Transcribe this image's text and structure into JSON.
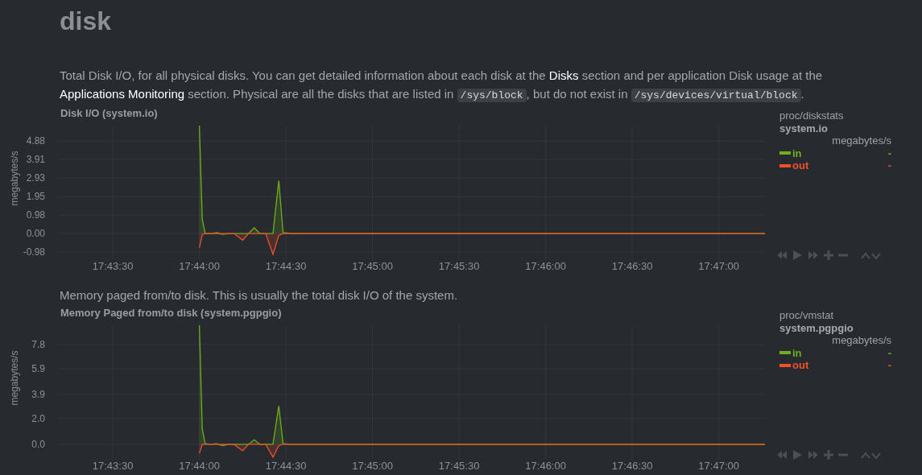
{
  "page": {
    "title": "disk"
  },
  "sections": [
    {
      "description": [
        {
          "kind": "text",
          "text": "Total Disk I/O, for all physical disks. You can get detailed information about each disk at the "
        },
        {
          "kind": "link",
          "text": "Disks"
        },
        {
          "kind": "text",
          "text": " section and per application Disk usage at the "
        },
        {
          "kind": "link",
          "text": "Applications Monitoring"
        },
        {
          "kind": "text",
          "text": " section. Physical are all the disks that are listed in "
        },
        {
          "kind": "code",
          "text": "/sys/block"
        },
        {
          "kind": "text",
          "text": ", but do not exist in "
        },
        {
          "kind": "code",
          "text": "/sys/devices/virtual/block"
        },
        {
          "kind": "text",
          "text": "."
        }
      ],
      "legend": {
        "source": "proc/diskstats",
        "context": "system.io",
        "units": "megabytes/s",
        "values": [
          "-",
          "-"
        ]
      },
      "chart_data": {
        "type": "area",
        "title": "Disk I/O (system.io)",
        "ylabel": "megabytes/s",
        "grid": true,
        "x": [
          63840,
          63841,
          63842,
          63844,
          63846,
          63848,
          63850,
          63852,
          63855,
          63857,
          63859,
          63861,
          63863,
          63865.5,
          63867.5,
          63869,
          63872,
          63880,
          63900,
          63940,
          63980,
          64036
        ],
        "series": [
          {
            "name": "in",
            "color": "#6fb01b",
            "values": [
              5.7,
              0.75,
              0,
              0,
              0.05,
              -0.05,
              0,
              0,
              0,
              0,
              0.3,
              0,
              0,
              0,
              2.8,
              0.05,
              0,
              0,
              0,
              0,
              0,
              0
            ]
          },
          {
            "name": "out",
            "color": "#f3502a",
            "values": [
              -0.75,
              -0.05,
              0,
              0,
              0,
              0,
              0,
              0,
              -0.35,
              0,
              0,
              0,
              0,
              -1.1,
              -0.1,
              0,
              0,
              0,
              0,
              0,
              0,
              0
            ]
          }
        ],
        "xlim": [
          63791,
          64036
        ],
        "ylim": [
          -1.4,
          5.7
        ],
        "xticks": [
          {
            "value": 63810,
            "label": "17:43:30"
          },
          {
            "value": 63840,
            "label": "17:44:00"
          },
          {
            "value": 63870,
            "label": "17:44:30"
          },
          {
            "value": 63900,
            "label": "17:45:00"
          },
          {
            "value": 63930,
            "label": "17:45:30"
          },
          {
            "value": 63960,
            "label": "17:46:00"
          },
          {
            "value": 63990,
            "label": "17:46:30"
          },
          {
            "value": 64020,
            "label": "17:47:00"
          }
        ],
        "yticks": [
          {
            "value": -0.98,
            "label": "-0.98"
          },
          {
            "value": 0,
            "label": "0.00"
          },
          {
            "value": 0.98,
            "label": "0.98"
          },
          {
            "value": 1.95,
            "label": "1.95"
          },
          {
            "value": 2.93,
            "label": "2.93"
          },
          {
            "value": 3.91,
            "label": "3.91"
          },
          {
            "value": 4.88,
            "label": "4.88"
          }
        ]
      }
    },
    {
      "description": [
        {
          "kind": "text",
          "text": "Memory paged from/to disk. This is usually the total disk I/O of the system."
        }
      ],
      "legend": {
        "source": "proc/vmstat",
        "context": "system.pgpgio",
        "units": "megabytes/s",
        "values": [
          "-",
          "-"
        ]
      },
      "chart_data": {
        "type": "area",
        "title": "Memory Paged from/to disk (system.pgpgio)",
        "ylabel": "megabytes/s",
        "grid": true,
        "x": [
          63840,
          63841,
          63842,
          63844,
          63846,
          63848,
          63850,
          63852,
          63855,
          63857,
          63859,
          63861,
          63863,
          63865.5,
          63867.5,
          63869,
          63872,
          63880,
          63900,
          63940,
          63980,
          64036
        ],
        "series": [
          {
            "name": "in",
            "color": "#6fb01b",
            "values": [
              9.3,
              1.2,
              0.05,
              0,
              0.05,
              -0.1,
              0,
              0,
              0,
              0,
              0.35,
              0,
              0,
              0,
              3.0,
              0.05,
              0,
              0,
              0,
              0,
              0,
              0
            ]
          },
          {
            "name": "out",
            "color": "#f3502a",
            "values": [
              -0.7,
              0,
              0,
              0,
              0,
              0,
              0,
              0,
              -0.5,
              0,
              0,
              0,
              0,
              -1.0,
              -0.1,
              0,
              0,
              0,
              0,
              0,
              0,
              0
            ]
          }
        ],
        "xlim": [
          63791,
          64036
        ],
        "ylim": [
          -1.2,
          9.3
        ],
        "xticks": [
          {
            "value": 63810,
            "label": "17:43:30"
          },
          {
            "value": 63840,
            "label": "17:44:00"
          },
          {
            "value": 63870,
            "label": "17:44:30"
          },
          {
            "value": 63900,
            "label": "17:45:00"
          },
          {
            "value": 63930,
            "label": "17:45:30"
          },
          {
            "value": 63960,
            "label": "17:46:00"
          },
          {
            "value": 63990,
            "label": "17:46:30"
          },
          {
            "value": 64020,
            "label": "17:47:00"
          }
        ],
        "yticks": [
          {
            "value": 0,
            "label": "0.0"
          },
          {
            "value": 2.0,
            "label": "2.0"
          },
          {
            "value": 3.9,
            "label": "3.9"
          },
          {
            "value": 5.9,
            "label": "5.9"
          },
          {
            "value": 7.8,
            "label": "7.8"
          }
        ]
      }
    }
  ]
}
